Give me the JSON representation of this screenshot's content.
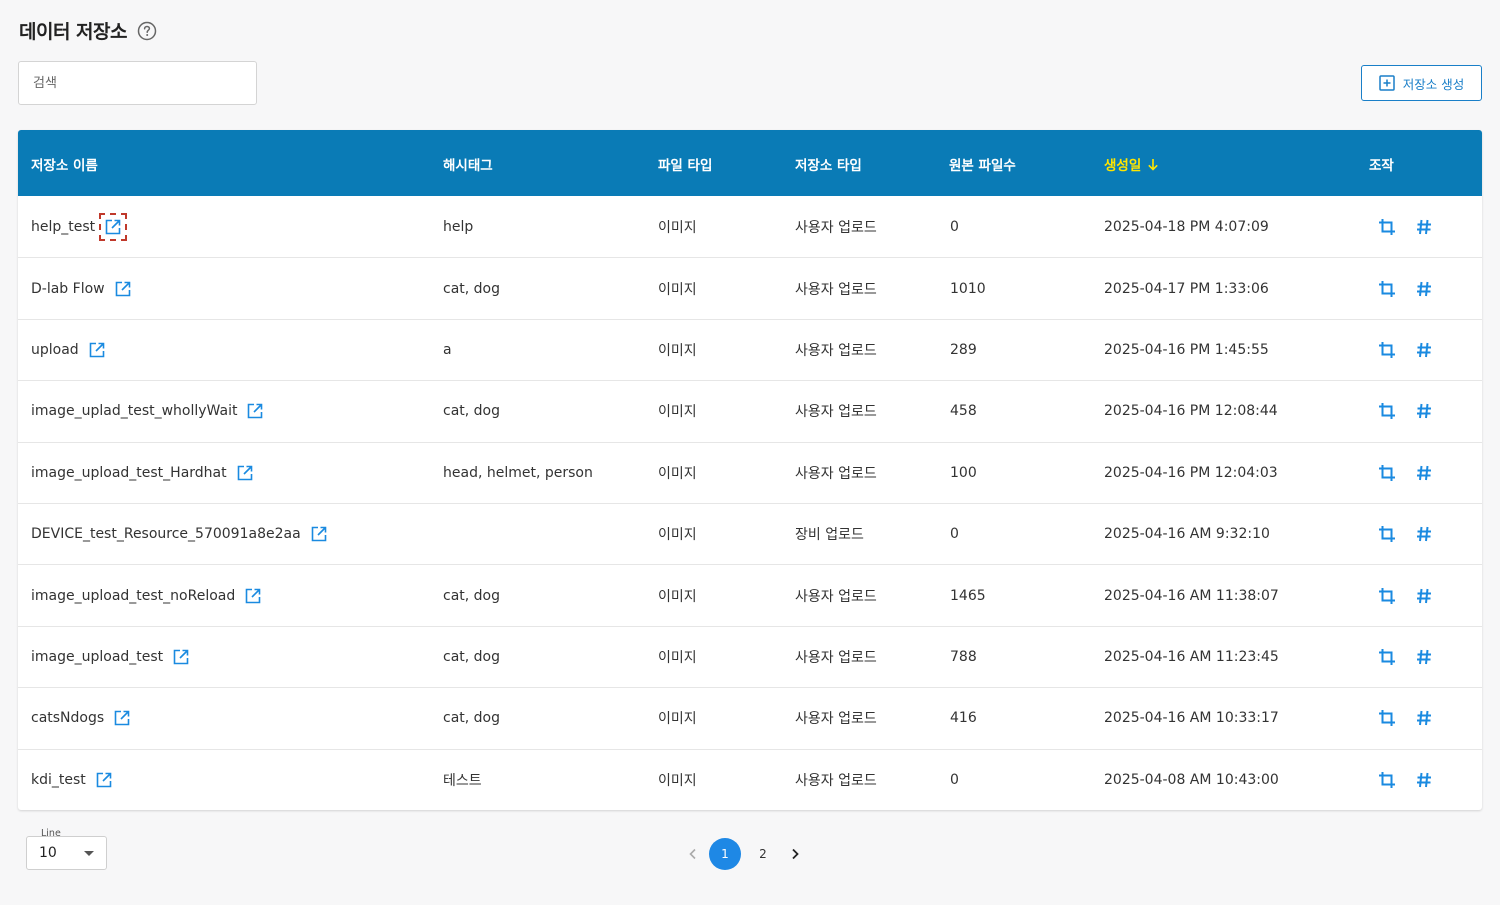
{
  "header": {
    "title": "데이터 저장소",
    "help_icon": "question-circle-icon"
  },
  "search": {
    "placeholder": "검색",
    "value": ""
  },
  "toolbar": {
    "create_label": "저장소 생성",
    "create_icon": "plus-square-icon"
  },
  "table": {
    "columns": {
      "name": "저장소 이름",
      "tags": "해시태그",
      "file_type": "파일 타입",
      "store_type": "저장소 타입",
      "count": "원본 파일수",
      "created": "생성일",
      "actions": "조작"
    },
    "sort": {
      "column": "created",
      "direction": "desc",
      "color": "#ffe500"
    },
    "header_color": "#0a7bb6",
    "rows": [
      {
        "name": "help_test",
        "tags": "help",
        "file_type": "이미지",
        "store_type": "사용자 업로드",
        "count": "0",
        "created": "2025-04-18 PM 4:07:09",
        "highlight": true
      },
      {
        "name": "D-lab Flow",
        "tags": "cat, dog",
        "file_type": "이미지",
        "store_type": "사용자 업로드",
        "count": "1010",
        "created": "2025-04-17 PM 1:33:06"
      },
      {
        "name": "upload",
        "tags": "a",
        "file_type": "이미지",
        "store_type": "사용자 업로드",
        "count": "289",
        "created": "2025-04-16 PM 1:45:55"
      },
      {
        "name": "image_uplad_test_whollyWait",
        "tags": "cat, dog",
        "file_type": "이미지",
        "store_type": "사용자 업로드",
        "count": "458",
        "created": "2025-04-16 PM 12:08:44"
      },
      {
        "name": "image_upload_test_Hardhat",
        "tags": "head, helmet, person",
        "file_type": "이미지",
        "store_type": "사용자 업로드",
        "count": "100",
        "created": "2025-04-16 PM 12:04:03"
      },
      {
        "name": "DEVICE_test_Resource_570091a8e2aa",
        "tags": "",
        "file_type": "이미지",
        "store_type": "장비 업로드",
        "count": "0",
        "created": "2025-04-16 AM 9:32:10"
      },
      {
        "name": "image_upload_test_noReload",
        "tags": "cat, dog",
        "file_type": "이미지",
        "store_type": "사용자 업로드",
        "count": "1465",
        "created": "2025-04-16 AM 11:38:07"
      },
      {
        "name": "image_upload_test",
        "tags": "cat, dog",
        "file_type": "이미지",
        "store_type": "사용자 업로드",
        "count": "788",
        "created": "2025-04-16 AM 11:23:45"
      },
      {
        "name": "catsNdogs",
        "tags": "cat, dog",
        "file_type": "이미지",
        "store_type": "사용자 업로드",
        "count": "416",
        "created": "2025-04-16 AM 10:33:17"
      },
      {
        "name": "kdi_test",
        "tags": "테스트",
        "file_type": "이미지",
        "store_type": "사용자 업로드",
        "count": "0",
        "created": "2025-04-08 AM 10:43:00"
      }
    ],
    "row_icons": {
      "link": "external-link-icon",
      "crop": "crop-icon",
      "tag": "hashtag-icon"
    }
  },
  "footer": {
    "line_label": "Line",
    "line_value": "10",
    "pages": [
      "1",
      "2"
    ],
    "current_page": "1"
  },
  "colors": {
    "accent": "#1e88e5",
    "icon_blue": "#1a8ae0"
  }
}
